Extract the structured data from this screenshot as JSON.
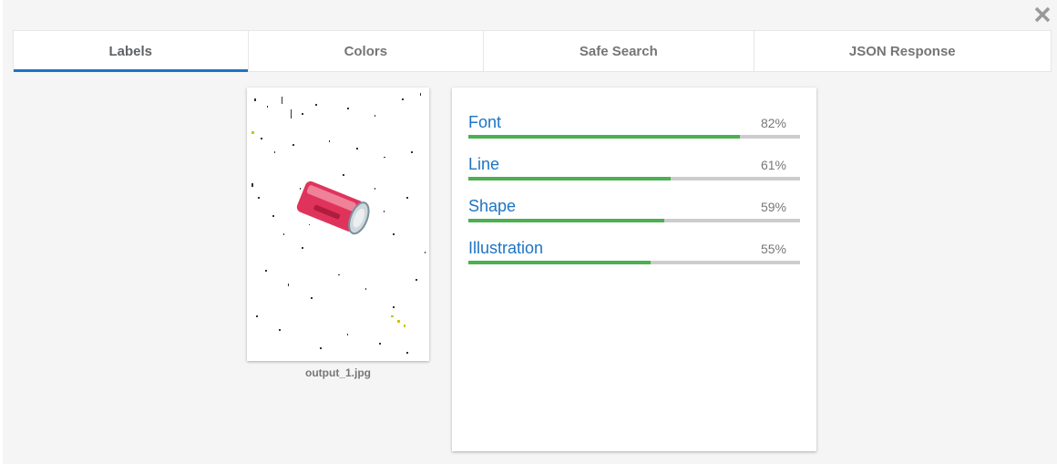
{
  "close": {
    "icon": "close-icon"
  },
  "tabs": [
    {
      "label": "Labels",
      "active": true
    },
    {
      "label": "Colors",
      "active": false
    },
    {
      "label": "Safe Search",
      "active": false
    },
    {
      "label": "JSON Response",
      "active": false
    }
  ],
  "image": {
    "filename": "output_1.jpg"
  },
  "labels": [
    {
      "name": "Font",
      "percent": "82%",
      "score": 0.82
    },
    {
      "name": "Line",
      "percent": "61%",
      "score": 0.61
    },
    {
      "name": "Shape",
      "percent": "59%",
      "score": 0.59
    },
    {
      "name": "Illustration",
      "percent": "55%",
      "score": 0.55
    }
  ],
  "colors": {
    "accent": "#1e74c4",
    "bar_fill": "#4caf50",
    "bar_track": "#cccccc"
  }
}
